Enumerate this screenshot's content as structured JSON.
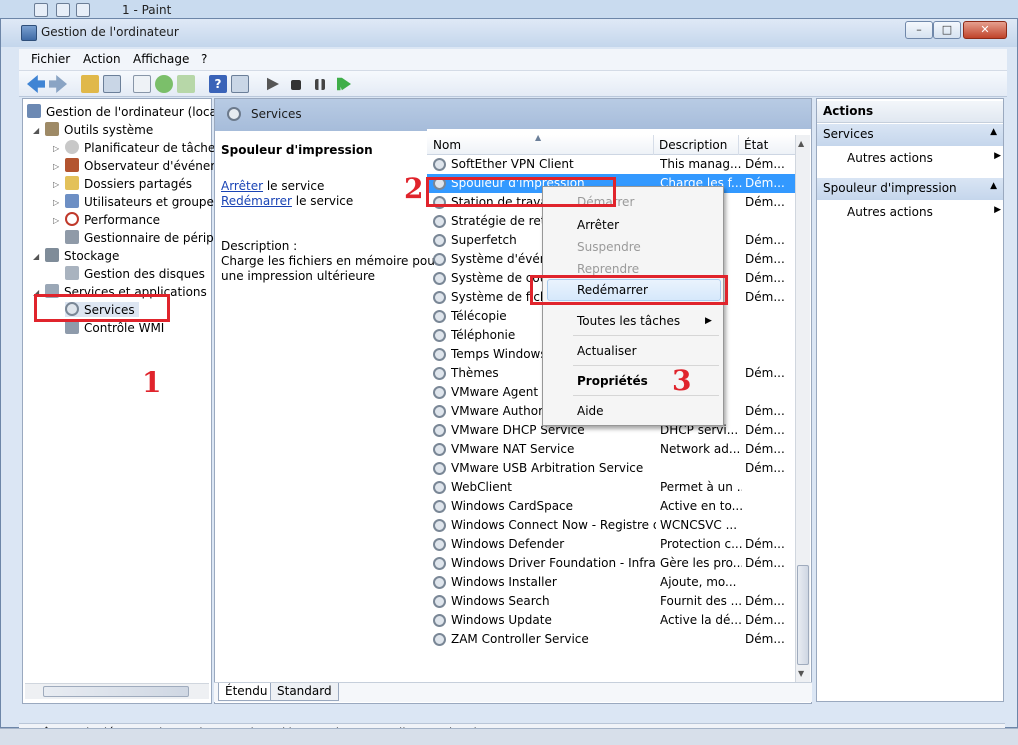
{
  "paint": {
    "title": "1 - Paint"
  },
  "window": {
    "title": "Gestion de l'ordinateur"
  },
  "menu": [
    "Fichier",
    "Action",
    "Affichage",
    "?"
  ],
  "tree": [
    "Gestion de l'ordinateur (local)",
    "Outils système",
    "Planificateur de tâches",
    "Observateur d'événeme",
    "Dossiers partagés",
    "Utilisateurs et groupes l",
    "Performance",
    "Gestionnaire de périphé",
    "Stockage",
    "Gestion des disques",
    "Services et applications",
    "Services",
    "Contrôle WMI"
  ],
  "center": {
    "header": "Services",
    "detail_title": "Spouleur d'impression",
    "stop_link": "Arrêter",
    "stop_text": "le service",
    "restart_link": "Redémarrer",
    "restart_text": "le service",
    "desc_label": "Description :",
    "desc_line1": "Charge les fichiers en mémoire pour",
    "desc_line2": "une impression ultérieure"
  },
  "columns": {
    "name": "Nom",
    "desc": "Description",
    "state": "État"
  },
  "rows": [
    {
      "name": "SoftEther VPN Client",
      "desc": "This manag...",
      "state": "Dém..."
    },
    {
      "name": "Spouleur d'impression",
      "desc": "Charge les f...",
      "state": "Dém..."
    },
    {
      "name": "Station de travail",
      "desc": "",
      "state": "Dém..."
    },
    {
      "name": "Stratégie de retrait",
      "desc": "",
      "state": ""
    },
    {
      "name": "Superfetch",
      "desc": "",
      "state": "Dém..."
    },
    {
      "name": "Système d'événements",
      "desc": "",
      "state": "Dém..."
    },
    {
      "name": "Système de couleurs",
      "desc": "",
      "state": "Dém..."
    },
    {
      "name": "Système de fichiers",
      "desc": "",
      "state": "Dém..."
    },
    {
      "name": "Télécopie",
      "desc": "",
      "state": ""
    },
    {
      "name": "Téléphonie",
      "desc": "",
      "state": ""
    },
    {
      "name": "Temps Windows",
      "desc": "",
      "state": ""
    },
    {
      "name": "Thèmes",
      "desc": "",
      "state": "Dém..."
    },
    {
      "name": "VMware Agent Service",
      "desc": "",
      "state": ""
    },
    {
      "name": "VMware Authorization",
      "desc": "",
      "state": "Dém..."
    },
    {
      "name": "VMware DHCP Service",
      "desc": "DHCP servi...",
      "state": "Dém..."
    },
    {
      "name": "VMware NAT Service",
      "desc": "Network ad...",
      "state": "Dém..."
    },
    {
      "name": "VMware USB Arbitration Service",
      "desc": "",
      "state": "Dém..."
    },
    {
      "name": "WebClient",
      "desc": "Permet à un ...",
      "state": ""
    },
    {
      "name": "Windows CardSpace",
      "desc": "Active en to...",
      "state": ""
    },
    {
      "name": "Windows Connect Now - Registre d...",
      "desc": "WCNCSVC ...",
      "state": ""
    },
    {
      "name": "Windows Defender",
      "desc": "Protection c...",
      "state": "Dém..."
    },
    {
      "name": "Windows Driver Foundation - Infrast...",
      "desc": "Gère les pro...",
      "state": "Dém..."
    },
    {
      "name": "Windows Installer",
      "desc": "Ajoute, mo...",
      "state": ""
    },
    {
      "name": "Windows Search",
      "desc": "Fournit des ...",
      "state": "Dém..."
    },
    {
      "name": "Windows Update",
      "desc": "Active la dé...",
      "state": "Dém..."
    },
    {
      "name": "ZAM Controller Service",
      "desc": "",
      "state": "Dém..."
    }
  ],
  "tabs": {
    "extended": "Étendu",
    "standard": "Standard"
  },
  "actions": {
    "title": "Actions",
    "section1": "Services",
    "more1": "Autres actions",
    "section2": "Spouleur d'impression",
    "more2": "Autres actions"
  },
  "context_menu": {
    "start": "Démarrer",
    "stop": "Arrêter",
    "pause": "Suspendre",
    "resume": "Reprendre",
    "restart": "Redémarrer",
    "all_tasks": "Toutes les tâches",
    "refresh": "Actualiser",
    "properties": "Propriétés",
    "help": "Aide"
  },
  "status": "Arrêter puis démarrer le service Spouleur d'impression sur Ordinateur local",
  "annotations": {
    "one": "1",
    "two": "2",
    "three": "3"
  },
  "colors": {
    "annotation_red": "#e0242c",
    "selection_blue": "#3399ff"
  }
}
